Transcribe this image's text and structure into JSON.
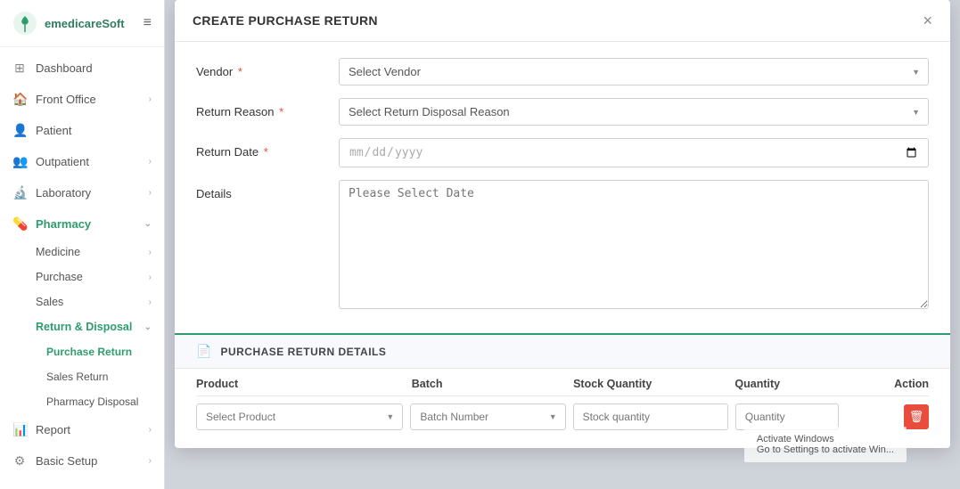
{
  "app": {
    "name": "emedicareSoft",
    "logo_alt": "leaf icon"
  },
  "sidebar": {
    "items": [
      {
        "id": "dashboard",
        "label": "Dashboard",
        "icon": "⊞",
        "active": false
      },
      {
        "id": "front-office",
        "label": "Front Office",
        "icon": "🏠",
        "active": false,
        "has_children": true
      },
      {
        "id": "patient",
        "label": "Patient",
        "icon": "👤",
        "active": false
      },
      {
        "id": "outpatient",
        "label": "Outpatient",
        "icon": "👥",
        "active": false,
        "has_children": true
      },
      {
        "id": "laboratory",
        "label": "Laboratory",
        "icon": "🔬",
        "active": false,
        "has_children": true
      },
      {
        "id": "pharmacy",
        "label": "Pharmacy",
        "icon": "💊",
        "active": true,
        "has_children": true
      }
    ],
    "pharmacy_sub": [
      {
        "id": "medicine",
        "label": "Medicine",
        "has_children": true
      },
      {
        "id": "purchase",
        "label": "Purchase",
        "has_children": true
      },
      {
        "id": "sales",
        "label": "Sales",
        "has_children": true
      },
      {
        "id": "return-disposal",
        "label": "Return & Disposal",
        "active": true,
        "has_children": true
      }
    ],
    "return_disposal_sub": [
      {
        "id": "purchase-return",
        "label": "Purchase Return",
        "active": true
      },
      {
        "id": "sales-return",
        "label": "Sales Return"
      },
      {
        "id": "pharmacy-disposal",
        "label": "Pharmacy Disposal"
      }
    ],
    "bottom_items": [
      {
        "id": "report",
        "label": "Report",
        "icon": "📊",
        "has_children": true
      },
      {
        "id": "basic-setup",
        "label": "Basic Setup",
        "icon": "⚙",
        "has_children": true
      }
    ]
  },
  "modal": {
    "title": "CREATE PURCHASE RETURN",
    "close_label": "×",
    "form": {
      "vendor_label": "Vendor",
      "vendor_placeholder": "Select Vendor",
      "return_reason_label": "Return Reason",
      "return_reason_placeholder": "Select Return Disposal Reason",
      "return_date_label": "Return Date",
      "return_date_placeholder": "yyyy/mm/dd",
      "details_label": "Details",
      "details_placeholder": "Please Select Date"
    },
    "details_section": {
      "icon": "📄",
      "title": "PURCHASE RETURN DETAILS",
      "table": {
        "columns": [
          "Product",
          "Batch",
          "Stock Quantity",
          "Quantity",
          "Action"
        ],
        "product_placeholder": "Select Product",
        "batch_placeholder": "Batch Number",
        "stock_qty_placeholder": "Stock quantity",
        "quantity_placeholder": "Quantity",
        "delete_label": "🗑"
      }
    }
  },
  "activation": {
    "line1": "Activate Windows",
    "line2": "Go to Settings to activate Win..."
  }
}
